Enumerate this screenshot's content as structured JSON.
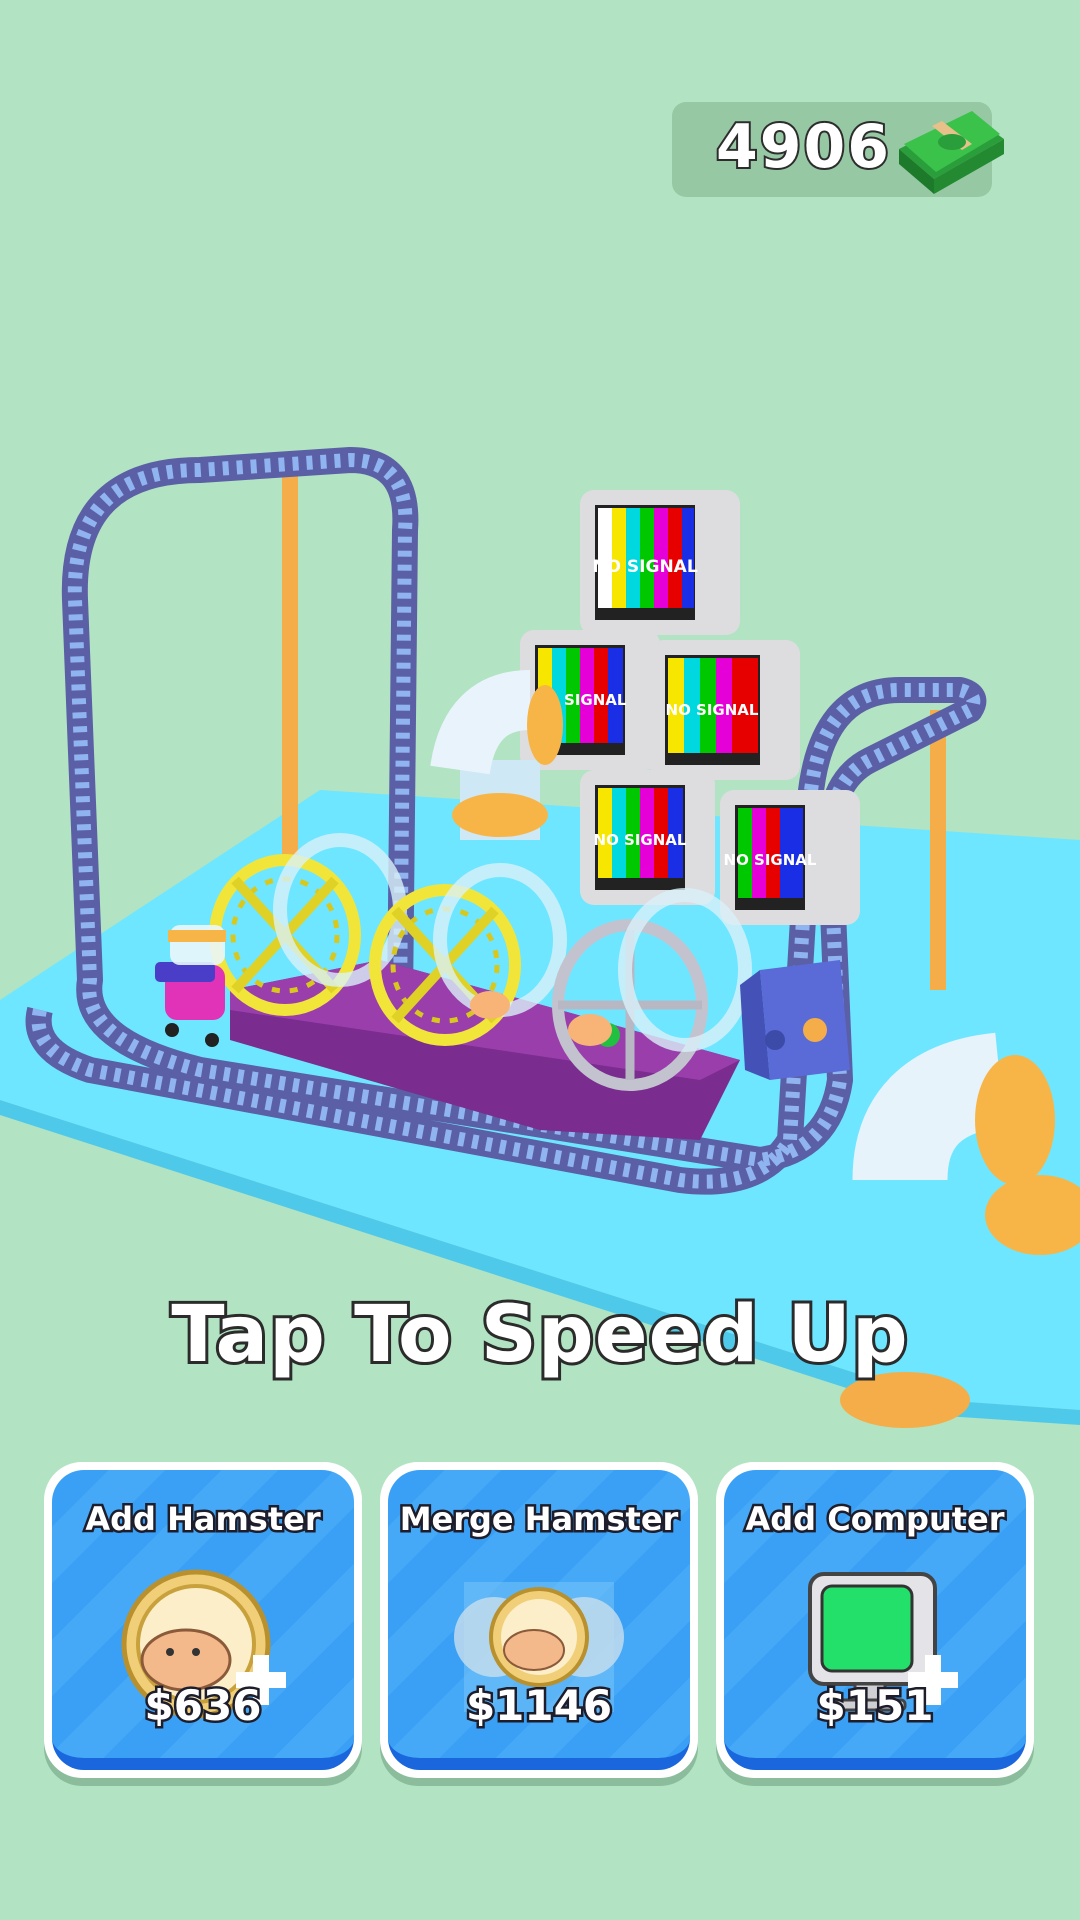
{
  "hud": {
    "coins": "4906",
    "currency_icon": "cash-stack-icon"
  },
  "scene": {
    "monitor_text": "NO SIGNAL"
  },
  "prompt": {
    "tap_text": "Tap To Speed Up"
  },
  "upgrades": [
    {
      "title": "Add Hamster",
      "price": "$636",
      "icon": "hamster-wheel-plus-icon"
    },
    {
      "title": "Merge Hamster",
      "price": "$1146",
      "icon": "merge-hamster-icon"
    },
    {
      "title": "Add Computer",
      "price": "$151",
      "icon": "computer-plus-icon"
    }
  ],
  "colors": {
    "background": "#b2e3c2",
    "platform": "#6ee6ff",
    "track": "#5b5fa6",
    "card_blue": "#3aa0f5",
    "wheel_gold": "#f2e53a"
  }
}
